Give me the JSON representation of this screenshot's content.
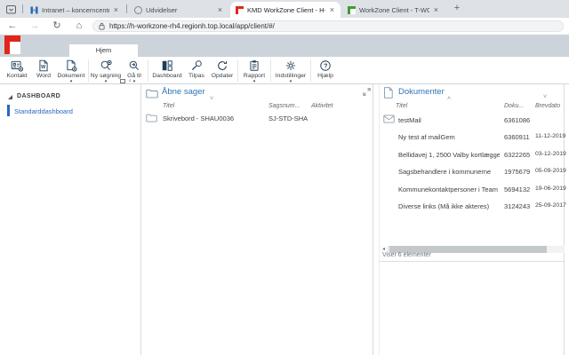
{
  "browser": {
    "tabs": [
      {
        "title": "Intranet – koncerncentrenes int",
        "favicon": "intranet-favicon"
      },
      {
        "title": "Udvidelser",
        "favicon": "extensions-favicon"
      },
      {
        "title": "KMD WorkZone Client - H-WOR",
        "favicon": "workzone-red-favicon",
        "active": true
      },
      {
        "title": "WorkZone Client - T-WORKZON",
        "favicon": "workzone-green-favicon"
      }
    ],
    "url": "https://h-workzone-rh4.regionh.top.local/app/client/#/"
  },
  "icons": {
    "close_glyph": "×",
    "new_tab_glyph": "+",
    "back_glyph": "←",
    "forward_glyph": "→",
    "refresh_glyph": "↻",
    "home_glyph": "⌂",
    "dropdown_caret_glyph": "▾",
    "sort_asc_glyph": "˄",
    "sort_desc_glyph": "˅",
    "scroll_left_glyph": "◂",
    "collapse_chevron_glyph": "‹"
  },
  "colors": {
    "workzone_red": "#e1251b",
    "title_blue": "#2e75b6",
    "link_blue": "#2a65c8",
    "ribbon_icon_navy": "#1f3d58",
    "word_blue": "#2b579a"
  },
  "app": {
    "ribbon_tab_label": "Hjem",
    "ribbon": {
      "buttons": [
        {
          "label": "Kontakt",
          "icon": "contact-add-icon"
        },
        {
          "label": "Word",
          "icon": "word-document-icon"
        },
        {
          "label": "Dokument",
          "icon": "new-document-icon",
          "caret": true
        },
        {
          "label": "Ny søgning",
          "icon": "new-search-icon",
          "caret": true
        },
        {
          "label": "Gå til",
          "icon": "goto-search-icon",
          "caret": true
        },
        {
          "label": "Dashboard",
          "icon": "dashboard-grid-icon"
        },
        {
          "label": "Tilpas",
          "icon": "customize-wrench-icon"
        },
        {
          "label": "Opdater",
          "icon": "refresh-arrow-icon"
        },
        {
          "label": "Rapport",
          "icon": "report-clipboard-icon",
          "caret": true
        },
        {
          "label": "Indstillinger",
          "icon": "settings-gear-icon",
          "caret": true
        },
        {
          "label": "Hjælp",
          "icon": "help-circle-icon"
        }
      ]
    },
    "sidebar": {
      "section_label": "DASHBOARD",
      "items": [
        {
          "label": "Standarddashboard",
          "selected": true
        }
      ]
    },
    "cases_panel": {
      "title": "Åbne sager",
      "columns": [
        "Titel",
        "Sagsnum...",
        "Aktivitet"
      ],
      "rows": [
        {
          "icon": "folder-icon",
          "title": "Skrivebord - SHAU0036",
          "case_no": "SJ-STD-SHA...",
          "activity": ""
        }
      ]
    },
    "docs_panel": {
      "title": "Dokumenter",
      "columns": [
        "Titel",
        "Doku...",
        "Brevdato"
      ],
      "rows": [
        {
          "icon": "mail-icon",
          "title": "testMail",
          "doc_no": "6361086",
          "letter_date": ""
        },
        {
          "icon": "word-file-icon",
          "title": "Ny test af mailGem",
          "doc_no": "6360911",
          "letter_date": "11-12-2019"
        },
        {
          "icon": "word-file-icon",
          "title": "Bellidavej 1, 2500 Valby kortlægges ikke",
          "doc_no": "6322265",
          "letter_date": "03-12-2019"
        },
        {
          "icon": "word-file-icon",
          "title": "Sagsbehandlere i kommunerne",
          "doc_no": "1975679",
          "letter_date": "05-09-2019"
        },
        {
          "icon": "word-file-icon",
          "title": "Kommunekontaktpersoner i Team Frivillig - ...",
          "doc_no": "5694132",
          "letter_date": "19-06-2019"
        },
        {
          "icon": "word-file-icon",
          "title": "Diverse links (Må ikke akteres)",
          "doc_no": "3124243",
          "letter_date": "25-09-2017"
        }
      ],
      "status": "Viser 6 elementer"
    }
  }
}
